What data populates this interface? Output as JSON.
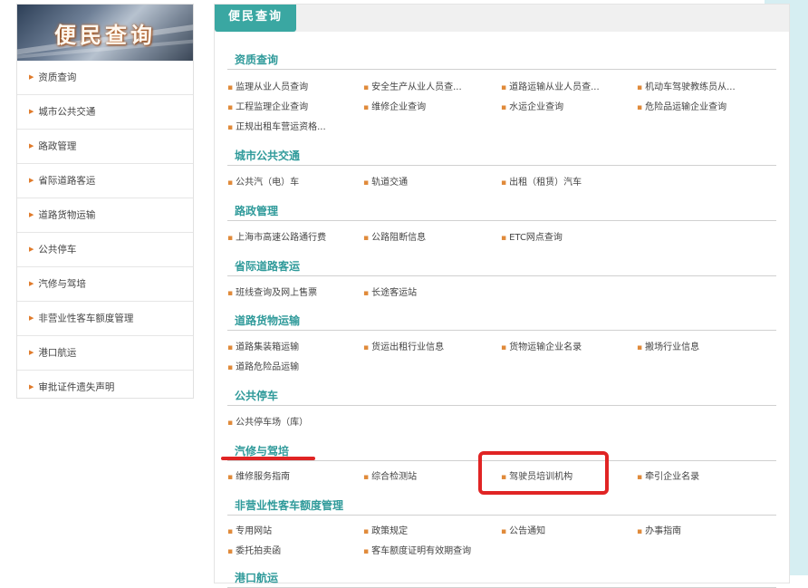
{
  "sidebar": {
    "banner_title": "便民查询",
    "items": [
      "资质查询",
      "城市公共交通",
      "路政管理",
      "省际道路客运",
      "道路货物运输",
      "公共停车",
      "汽修与驾培",
      "非营业性客车额度管理",
      "港口航运",
      "审批证件遗失声明"
    ]
  },
  "main": {
    "tab_title": "便民查询",
    "sections": [
      {
        "title": "资质查询",
        "links": [
          "监理从业人员查询",
          "安全生产从业人员查...",
          "道路运输从业人员查...",
          "机动车驾驶教练员从...",
          "工程监理企业查询",
          "维修企业查询",
          "水运企业查询",
          "危险品运输企业查询",
          "正规出租车营运资格..."
        ]
      },
      {
        "title": "城市公共交通",
        "links": [
          "公共汽（电）车",
          "轨道交通",
          "出租（租赁）汽车"
        ]
      },
      {
        "title": "路政管理",
        "links": [
          "上海市高速公路通行费",
          "公路阻断信息",
          "ETC网点查询"
        ]
      },
      {
        "title": "省际道路客运",
        "links": [
          "班线查询及网上售票",
          "长途客运站"
        ]
      },
      {
        "title": "道路货物运输",
        "links": [
          "道路集装箱运输",
          "货运出租行业信息",
          "货物运输企业名录",
          "搬场行业信息",
          "道路危险品运输"
        ]
      },
      {
        "title": "公共停车",
        "links": [
          "公共停车场（库）"
        ]
      },
      {
        "title": "汽修与驾培",
        "links": [
          "维修服务指南",
          "综合检测站",
          "驾驶员培训机构",
          "牵引企业名录"
        ]
      },
      {
        "title": "非营业性客车额度管理",
        "links": [
          "专用网站",
          "政策规定",
          "公告通知",
          "办事指南",
          "委托拍卖函",
          "客车额度证明有效期查询"
        ]
      },
      {
        "title": "港口航运",
        "links": []
      }
    ]
  },
  "colors": {
    "accent": "#3aa7a2",
    "section_title": "#2f9a9a",
    "highlight": "#e02424",
    "bullet": "#e08a3a"
  }
}
